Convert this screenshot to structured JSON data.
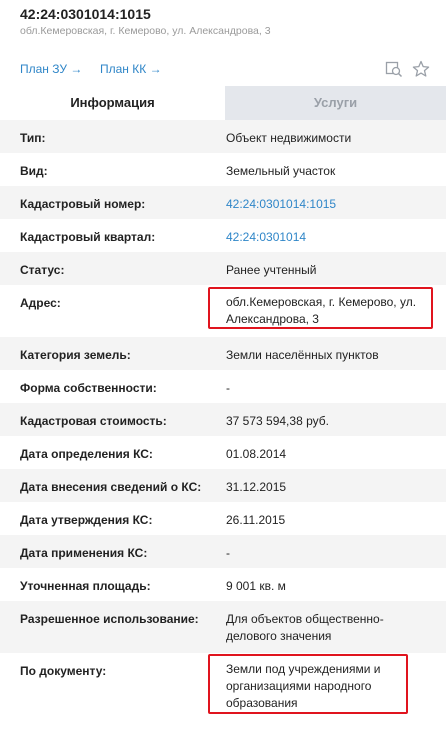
{
  "header": {
    "title": "42:24:0301014:1015",
    "subtitle": "обл.Кемеровская, г. Кемерово, ул. Александрова, 3"
  },
  "links": {
    "plan_zu": "План ЗУ →",
    "plan_kk": "План КК →"
  },
  "icons": {
    "search": "search-map-icon",
    "favorite": "star-icon"
  },
  "tabs": [
    {
      "label": "Информация",
      "active": true
    },
    {
      "label": "Услуги",
      "active": false
    }
  ],
  "rows": [
    {
      "label": "Тип:",
      "value": "Объект недвижимости"
    },
    {
      "label": "Вид:",
      "value": "Земельный участок"
    },
    {
      "label": "Кадастровый номер:",
      "value": "42:24:0301014:1015",
      "link": true
    },
    {
      "label": "Кадастровый квартал:",
      "value": "42:24:0301014",
      "link": true
    },
    {
      "label": "Статус:",
      "value": "Ранее учтенный"
    },
    {
      "label": "Адрес:",
      "value": "обл.Кемеровская, г. Кемерово, ул. Александрова, 3",
      "highlighted": true
    },
    {
      "label": "Категория земель:",
      "value": "Земли населённых пунктов"
    },
    {
      "label": "Форма собственности:",
      "value": "-"
    },
    {
      "label": "Кадастровая стоимость:",
      "value": "37 573 594,38 руб."
    },
    {
      "label": "Дата определения КС:",
      "value": "01.08.2014"
    },
    {
      "label": "Дата внесения сведений о КС:",
      "value": "31.12.2015"
    },
    {
      "label": "Дата утверждения КС:",
      "value": "26.11.2015"
    },
    {
      "label": "Дата применения КС:",
      "value": "-"
    },
    {
      "label": "Уточненная площадь:",
      "value": "9 001 кв. м"
    },
    {
      "label": "Разрешенное использование:",
      "value": "Для объектов общественно-делового значения"
    },
    {
      "label": "По документу:",
      "value": "Земли под учреждениями и организациями народного образования",
      "highlighted": true
    }
  ],
  "colors": {
    "link": "#2f86c8",
    "highlight_border": "#e0141e",
    "stripe": "#f4f4f4",
    "inactive_tab": "#e4e7ec"
  }
}
